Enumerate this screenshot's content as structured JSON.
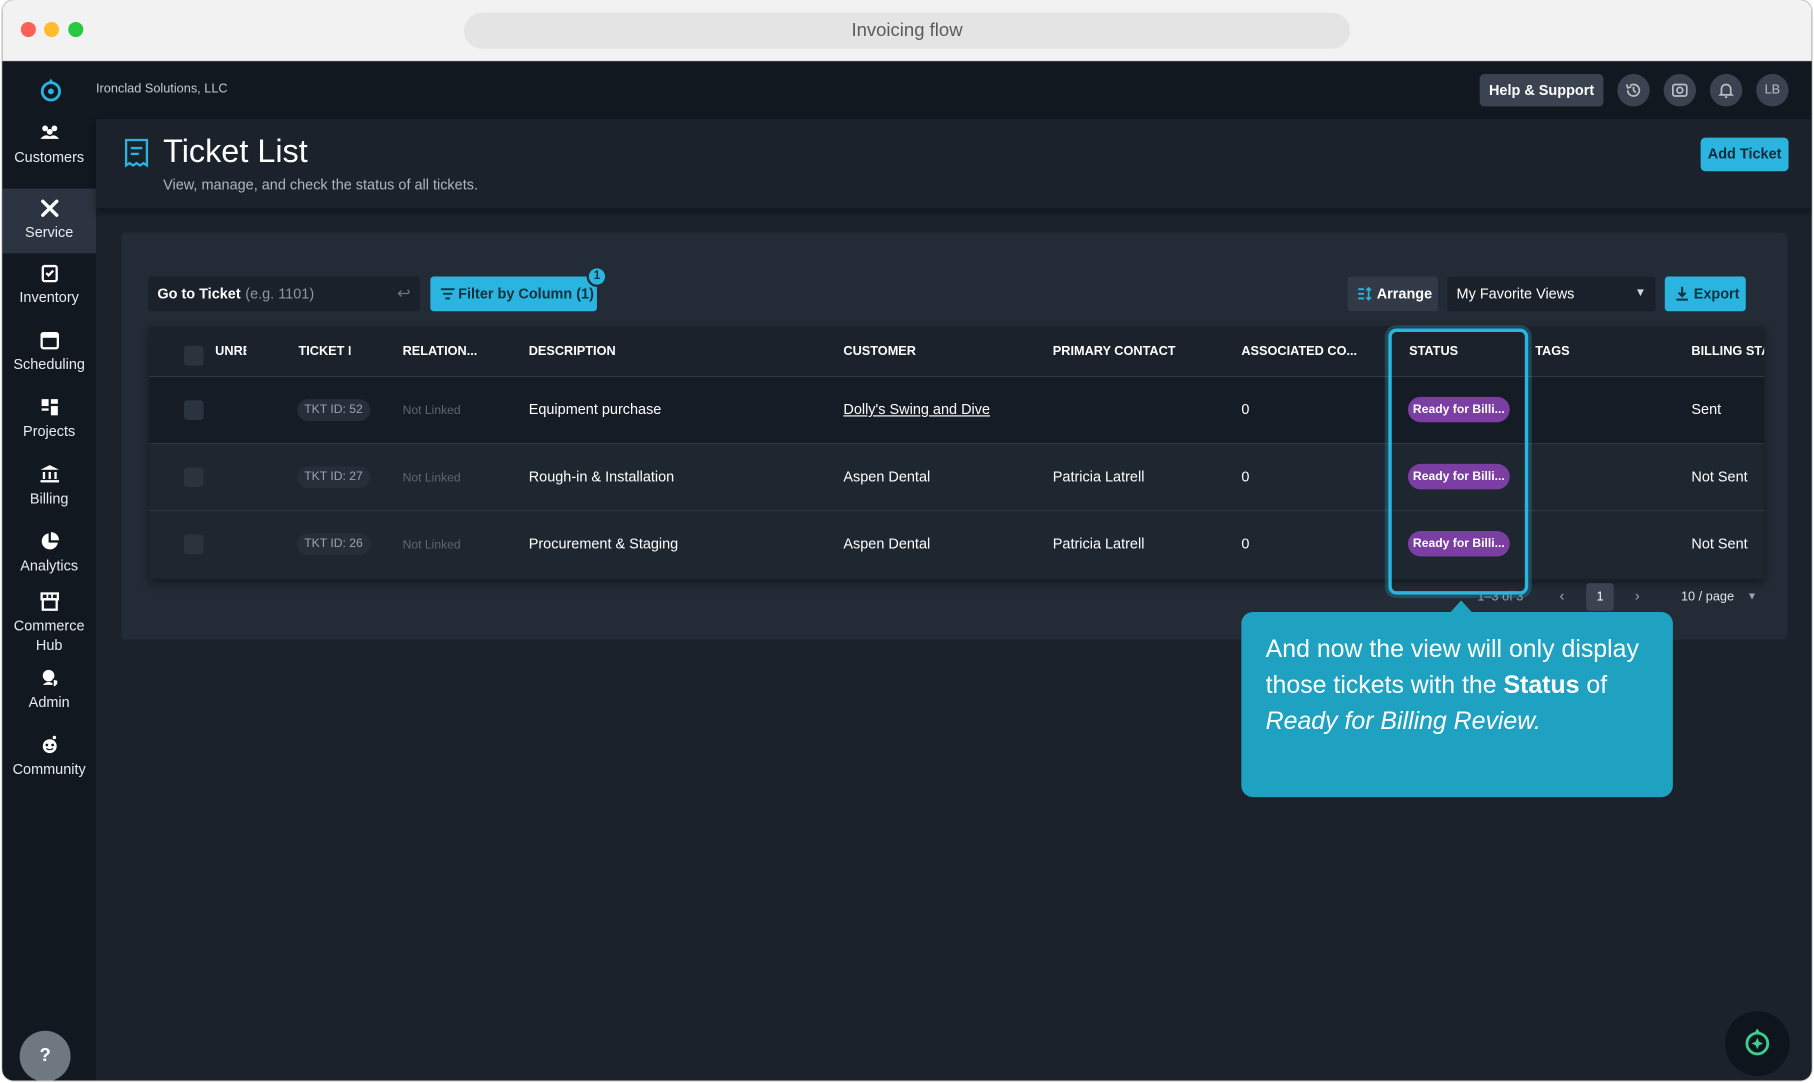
{
  "window": {
    "title": "Invoicing flow"
  },
  "topbar": {
    "company": "Ironclad Solutions, LLC",
    "help_support": "Help & Support",
    "avatar": "LB"
  },
  "sidebar": {
    "items": [
      {
        "label": "Customers",
        "icon": "customers-icon"
      },
      {
        "label": "Service",
        "icon": "service-icon"
      },
      {
        "label": "Inventory",
        "icon": "inventory-icon"
      },
      {
        "label": "Scheduling",
        "icon": "calendar-icon"
      },
      {
        "label": "Projects",
        "icon": "projects-icon"
      },
      {
        "label": "Billing",
        "icon": "bank-icon"
      },
      {
        "label": "Analytics",
        "icon": "pie-chart-icon"
      },
      {
        "label": "Commerce Hub",
        "icon": "store-icon"
      },
      {
        "label": "Admin",
        "icon": "admin-shield-icon"
      },
      {
        "label": "Community",
        "icon": "community-icon"
      }
    ],
    "active": "Service",
    "help": "?"
  },
  "page": {
    "title": "Ticket List",
    "subtitle": "View, manage, and check the status of all tickets.",
    "add_button": "Add Ticket"
  },
  "toolbar": {
    "goto_label": "Go to Ticket",
    "goto_placeholder": "(e.g. 1101)",
    "filter_label": "Filter by Column (1)",
    "filter_badge": "1",
    "arrange_label": "Arrange",
    "views_selected": "My Favorite Views",
    "export_label": "Export"
  },
  "table": {
    "columns": [
      "UNRE",
      "TICKET I",
      "RELATION...",
      "DESCRIPTION",
      "CUSTOMER",
      "PRIMARY CONTACT",
      "ASSOCIATED CO...",
      "STATUS",
      "TAGS",
      "BILLING STA"
    ],
    "rows": [
      {
        "ticket": "TKT ID: 52",
        "relation": "Not Linked",
        "description": "Equipment purchase",
        "customer": "Dolly's Swing and Dive",
        "contact": "",
        "associated": "0",
        "status": "Ready for Billi...",
        "tags": "",
        "billing": "Sent"
      },
      {
        "ticket": "TKT ID: 27",
        "relation": "Not Linked",
        "description": "Rough-in & Installation",
        "customer": "Aspen Dental",
        "contact": "Patricia Latrell",
        "associated": "0",
        "status": "Ready for Billi...",
        "tags": "",
        "billing": "Not Sent"
      },
      {
        "ticket": "TKT ID: 26",
        "relation": "Not Linked",
        "description": "Procurement & Staging",
        "customer": "Aspen Dental",
        "contact": "Patricia Latrell",
        "associated": "0",
        "status": "Ready for Billi...",
        "tags": "",
        "billing": "Not Sent"
      }
    ]
  },
  "pagination": {
    "range": "1–3 of 3",
    "current_page": "1",
    "page_size": "10 / page"
  },
  "callout": {
    "text_1": "And now the view will only display those tickets with the ",
    "bold": "Status",
    "text_2": " of ",
    "italic": "Ready for Billing Review."
  },
  "colors": {
    "accent": "#2ab4e0",
    "status_pill": "#7b3fa3",
    "callout": "#1fa2c2",
    "background": "#1b222c"
  }
}
